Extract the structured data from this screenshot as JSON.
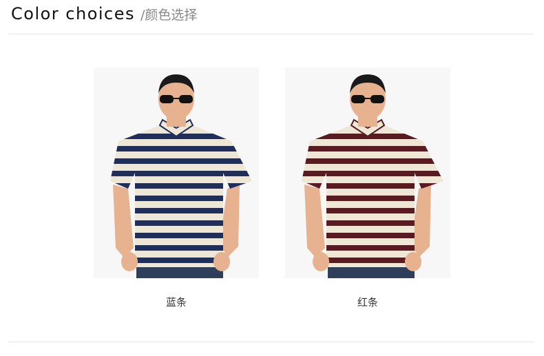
{
  "header": {
    "title": "Color choices",
    "subtitle": "/颜色选择"
  },
  "products": [
    {
      "label": "蓝条",
      "image_icon": "man-blue-striped-polo-photo",
      "colors": {
        "stripe": "#1f2e5a",
        "base": "#efe7d6",
        "pants": "#2f3e5a"
      }
    },
    {
      "label": "红条",
      "image_icon": "man-red-striped-polo-photo",
      "colors": {
        "stripe": "#5a1a22",
        "base": "#efe7d6",
        "pants": "#2f3e5a"
      }
    }
  ]
}
